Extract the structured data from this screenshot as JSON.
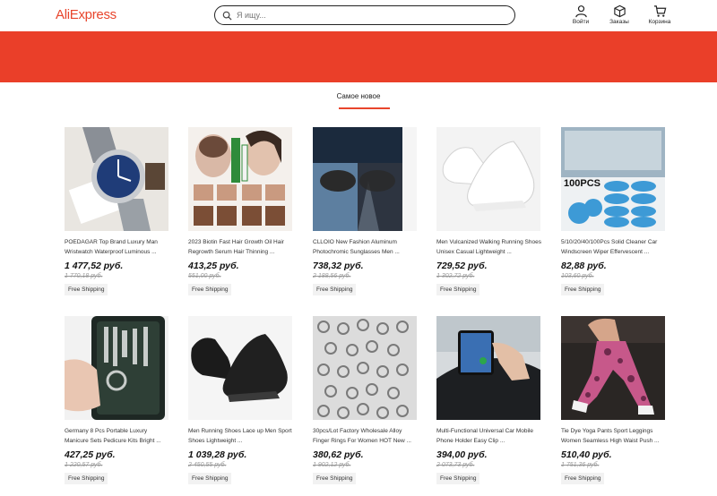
{
  "header": {
    "logo": "AliExpress",
    "search_placeholder": "Я ищу...",
    "login_label": "Войти",
    "orders_label": "Заказы",
    "cart_label": "Корзина"
  },
  "colors": {
    "accent": "#ea3f29",
    "logo": "#e8452c"
  },
  "section": {
    "title": "Самое новое"
  },
  "products": [
    {
      "title": "POEDAGAR Top Brand Luxury Man Wristwatch Waterproof Luminous ...",
      "price": "1 477,52 руб.",
      "old_price": "1 770,18 руб.",
      "shipping": "Free Shipping",
      "image": "watch"
    },
    {
      "title": "2023 Biotin Fast Hair Growth Oil Hair Regrowth Serum Hair Thinning ...",
      "price": "413,25 руб.",
      "old_price": "551,00 руб.",
      "shipping": "Free Shipping",
      "image": "hair-serum"
    },
    {
      "title": "CLLOIO New Fashion Aluminum Photochromic Sunglasses Men ...",
      "price": "738,32 руб.",
      "old_price": "2 188,56 руб.",
      "shipping": "Free Shipping",
      "image": "sunglasses"
    },
    {
      "title": "Men Vulcanized Walking Running Shoes Unisex Casual Lightweight ...",
      "price": "729,52 руб.",
      "old_price": "1 302,72 руб.",
      "shipping": "Free Shipping",
      "image": "white-sneakers"
    },
    {
      "title": "5/10/20/40/100Pcs Solid Cleaner Car Windscreen Wiper Effervescent ...",
      "price": "82,88 руб.",
      "old_price": "103,60 руб.",
      "shipping": "Free Shipping",
      "image": "cleaner-tablets"
    },
    {
      "title": "Germany 8 Pcs Portable Luxury Manicure Sets Pedicure Kits Bright ...",
      "price": "427,25 руб.",
      "old_price": "1 220,57 руб.",
      "shipping": "Free Shipping",
      "image": "manicure-set"
    },
    {
      "title": "Men Running Shoes Lace up Men Sport Shoes Lightweight ...",
      "price": "1 039,28 руб.",
      "old_price": "2 450,55 руб.",
      "shipping": "Free Shipping",
      "image": "black-sneakers"
    },
    {
      "title": "30pcs/Lot Factory Wholesale Alloy Finger Rings For Women HOT New ...",
      "price": "380,62 руб.",
      "old_price": "1 902,12 руб.",
      "shipping": "Free Shipping",
      "image": "rings"
    },
    {
      "title": "Multi-Functional Universal Car Mobile Phone Holder Easy Clip ...",
      "price": "394,00 руб.",
      "old_price": "2 073,73 руб.",
      "shipping": "Free Shipping",
      "image": "phone-holder"
    },
    {
      "title": "Tie Dye Yoga Pants Sport Leggings Women Seamless High Waist Push ...",
      "price": "510,40 руб.",
      "old_price": "1 751,36 руб.",
      "shipping": "Free Shipping",
      "image": "leggings"
    }
  ]
}
